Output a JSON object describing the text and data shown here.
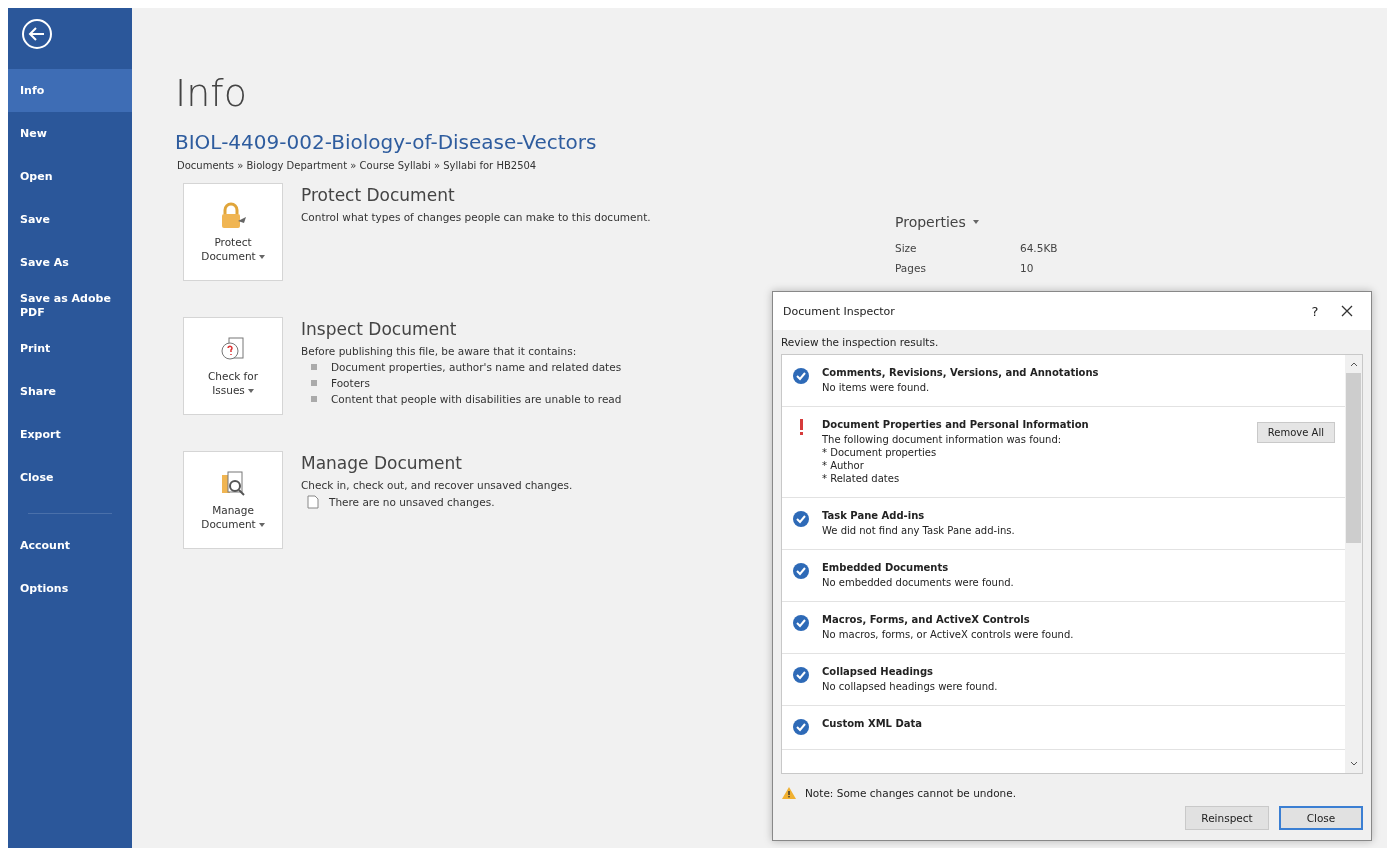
{
  "sidebar": {
    "items": [
      {
        "label": "Info",
        "selected": true
      },
      {
        "label": "New",
        "selected": false
      },
      {
        "label": "Open",
        "selected": false
      },
      {
        "label": "Save",
        "selected": false
      },
      {
        "label": "Save As",
        "selected": false
      },
      {
        "label": "Save as Adobe PDF",
        "selected": false
      },
      {
        "label": "Print",
        "selected": false
      },
      {
        "label": "Share",
        "selected": false
      },
      {
        "label": "Export",
        "selected": false
      },
      {
        "label": "Close",
        "selected": false
      }
    ],
    "bottom_items": [
      {
        "label": "Account",
        "selected": false
      },
      {
        "label": "Options",
        "selected": false
      }
    ]
  },
  "page_title": "Info",
  "document": {
    "title": "BIOL-4409-002-Biology-of-Disease-Vectors",
    "path": "Documents » Biology Department » Course Syllabi » Syllabi for HB2504"
  },
  "sections": [
    {
      "kind": "protect",
      "button_label": "Protect Document",
      "heading": "Protect Document",
      "description": "Control what types of changes people can make to this document."
    },
    {
      "kind": "inspect",
      "button_label": "Check for Issues",
      "heading": "Inspect Document",
      "description": "Before publishing this file, be aware that it contains:",
      "bullets": [
        "Document properties, author's name and related dates",
        "Footers",
        "Content that people with disabilities are unable to read"
      ]
    },
    {
      "kind": "manage",
      "button_label": "Manage Document",
      "heading": "Manage Document",
      "description": "Check in, check out, and recover unsaved changes.",
      "note": "There are no unsaved changes."
    }
  ],
  "properties": {
    "title": "Properties",
    "rows": [
      {
        "label": "Size",
        "value": "64.5KB"
      },
      {
        "label": "Pages",
        "value": "10"
      }
    ]
  },
  "dialog": {
    "title": "Document Inspector",
    "help": "?",
    "subtitle": "Review the inspection results.",
    "results": [
      {
        "kind": "ok",
        "title": "Comments, Revisions, Versions, and Annotations",
        "lines": [
          "No items were found."
        ]
      },
      {
        "kind": "issue",
        "title": "Document Properties and Personal Information",
        "lines": [
          "The following document information was found:",
          "* Document properties",
          "* Author",
          "* Related dates"
        ],
        "action": "Remove All"
      },
      {
        "kind": "ok",
        "title": "Task Pane Add-ins",
        "lines": [
          "We did not find any Task Pane add-ins."
        ]
      },
      {
        "kind": "ok",
        "title": "Embedded Documents",
        "lines": [
          "No embedded documents were found."
        ]
      },
      {
        "kind": "ok",
        "title": "Macros, Forms, and ActiveX Controls",
        "lines": [
          "No macros, forms, or ActiveX controls were found."
        ]
      },
      {
        "kind": "ok",
        "title": "Collapsed Headings",
        "lines": [
          "No collapsed headings were found."
        ]
      },
      {
        "kind": "ok",
        "title": "Custom XML Data"
      }
    ],
    "note": "Note: Some changes cannot be undone.",
    "buttons": [
      {
        "label": "Reinspect",
        "default": false
      },
      {
        "label": "Close",
        "default": true
      }
    ]
  }
}
